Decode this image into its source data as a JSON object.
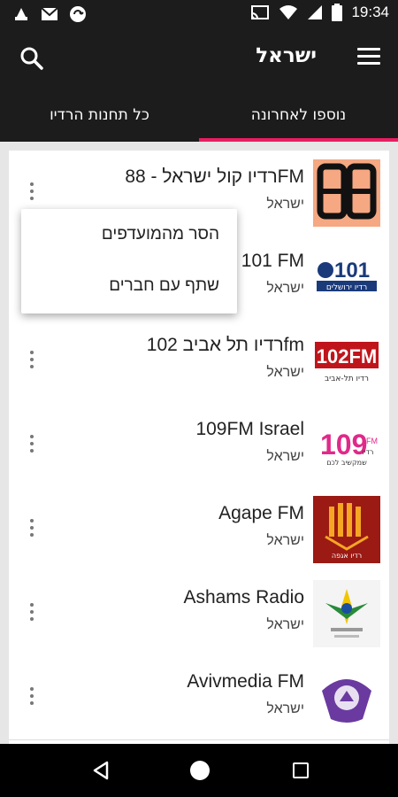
{
  "status_bar": {
    "time": "19:34",
    "left_icons": [
      "android-icon",
      "mail-icon",
      "sync-icon"
    ],
    "right_icons": [
      "cast-icon",
      "wifi-icon",
      "signal-icon",
      "battery-icon"
    ]
  },
  "app_bar": {
    "title": "ישראל",
    "menu_icon": "menu-icon",
    "search_icon": "search-icon"
  },
  "tabs": [
    {
      "label": "כל תחנות הרדיו",
      "active": false
    },
    {
      "label": "נוספו לאחרונה",
      "active": true
    }
  ],
  "accent_color": "#e91e63",
  "stations": [
    {
      "name": "רדיו קול ישראל - 88FM",
      "country": "ישראל",
      "logo": "88"
    },
    {
      "name": "101 FM",
      "country": "ישראל",
      "logo": "101"
    },
    {
      "name": "רדיו תל אביב 102fm",
      "country": "ישראל",
      "logo": "102FM"
    },
    {
      "name": "109FM Israel",
      "country": "ישראל",
      "logo": "109"
    },
    {
      "name": "Agape FM",
      "country": "ישראל",
      "logo": "agape"
    },
    {
      "name": "Ashams Radio",
      "country": "ישראל",
      "logo": "ashams"
    },
    {
      "name": "Avivmedia FM",
      "country": "ישראל",
      "logo": "aviv"
    }
  ],
  "popup_menu": {
    "items": [
      "הסר מהמועדפים",
      "שתף עם חברים"
    ]
  },
  "logo_text": {
    "logo_101_sub": "רדיו ירושלים",
    "logo_102_sub": "רדיו תל-אביב",
    "logo_109_sub1": "רדיו",
    "logo_109_sub2": "שמקשיב לכם",
    "logo_agape_sub": "רדיו אגפה"
  },
  "nav_bar": {
    "icons": [
      "back-icon",
      "home-icon",
      "recents-icon"
    ]
  }
}
